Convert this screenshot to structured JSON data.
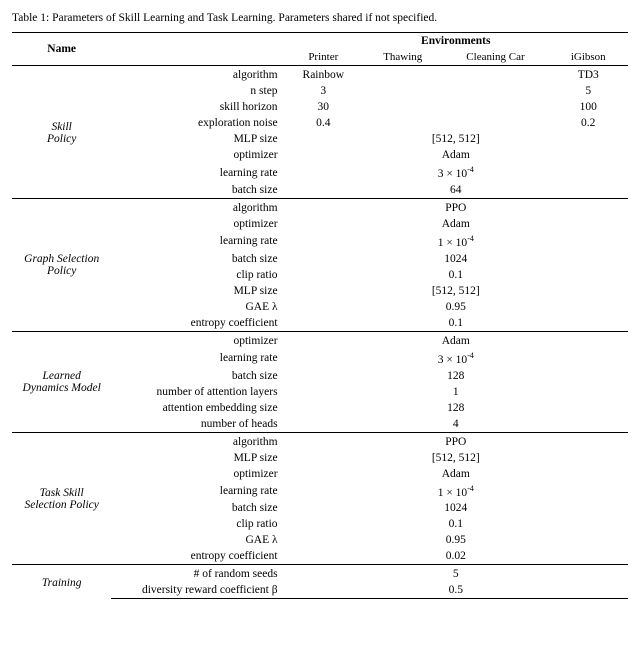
{
  "caption": "Table 1: Parameters of Skill Learning and Task Learning. Parameters shared if not specified.",
  "headers": {
    "name": "Name",
    "environments": "Environments",
    "cols": [
      "Printer",
      "Thawing",
      "Cleaning Car",
      "iGibson"
    ]
  },
  "sections": [
    {
      "label": "Skill\nPolicy",
      "rows": [
        {
          "param": "algorithm",
          "shared": null,
          "printer": "Rainbow",
          "thawing": null,
          "cleaning": null,
          "igibson": "TD3"
        },
        {
          "param": "n step",
          "shared": null,
          "printer": "3",
          "thawing": null,
          "cleaning": null,
          "igibson": "5"
        },
        {
          "param": "skill horizon",
          "shared": null,
          "printer": "30",
          "thawing": null,
          "cleaning": null,
          "igibson": "100"
        },
        {
          "param": "exploration noise",
          "shared": null,
          "printer": "0.4",
          "thawing": null,
          "cleaning": null,
          "igibson": "0.2"
        },
        {
          "param": "MLP size",
          "shared": "[512, 512]",
          "printer": null,
          "thawing": null,
          "cleaning": null,
          "igibson": null
        },
        {
          "param": "optimizer",
          "shared": "Adam",
          "printer": null,
          "thawing": null,
          "cleaning": null,
          "igibson": null
        },
        {
          "param": "learning rate",
          "shared": null,
          "printer": null,
          "thawing": null,
          "cleaning": null,
          "igibson": null,
          "lr": true,
          "lr_base": "3",
          "lr_exp": "-4"
        },
        {
          "param": "batch size",
          "shared": "64",
          "printer": null,
          "thawing": null,
          "cleaning": null,
          "igibson": null
        }
      ]
    },
    {
      "label": "Graph Selection\nPolicy",
      "rows": [
        {
          "param": "algorithm",
          "shared": "PPO"
        },
        {
          "param": "optimizer",
          "shared": "Adam"
        },
        {
          "param": "learning rate",
          "shared": null,
          "lr": true,
          "lr_base": "1",
          "lr_exp": "-4"
        },
        {
          "param": "batch size",
          "shared": "1024"
        },
        {
          "param": "clip ratio",
          "shared": "0.1"
        },
        {
          "param": "MLP size",
          "shared": "[512, 512]"
        },
        {
          "param": "GAE λ",
          "shared": "0.95"
        },
        {
          "param": "entropy coefficient",
          "shared": "0.1"
        }
      ]
    },
    {
      "label": "Learned\nDynamics Model",
      "rows": [
        {
          "param": "optimizer",
          "shared": "Adam"
        },
        {
          "param": "learning rate",
          "shared": null,
          "lr": true,
          "lr_base": "3",
          "lr_exp": "-4"
        },
        {
          "param": "batch size",
          "shared": "128"
        },
        {
          "param": "number of attention layers",
          "shared": "1"
        },
        {
          "param": "attention embedding size",
          "shared": "128"
        },
        {
          "param": "number of heads",
          "shared": "4"
        }
      ]
    },
    {
      "label": "Task Skill\nSelection Policy",
      "rows": [
        {
          "param": "algorithm",
          "shared": "PPO"
        },
        {
          "param": "MLP size",
          "shared": "[512, 512]"
        },
        {
          "param": "optimizer",
          "shared": "Adam"
        },
        {
          "param": "learning rate",
          "shared": null,
          "lr": true,
          "lr_base": "1",
          "lr_exp": "-4"
        },
        {
          "param": "batch size",
          "shared": "1024"
        },
        {
          "param": "clip ratio",
          "shared": "0.1"
        },
        {
          "param": "GAE λ",
          "shared": "0.95"
        },
        {
          "param": "entropy coefficient",
          "shared": "0.02"
        }
      ]
    },
    {
      "label": "Training",
      "rows": [
        {
          "param": "# of random seeds",
          "shared": "5"
        },
        {
          "param": "diversity reward coefficient β",
          "shared": "0.5"
        }
      ]
    }
  ]
}
